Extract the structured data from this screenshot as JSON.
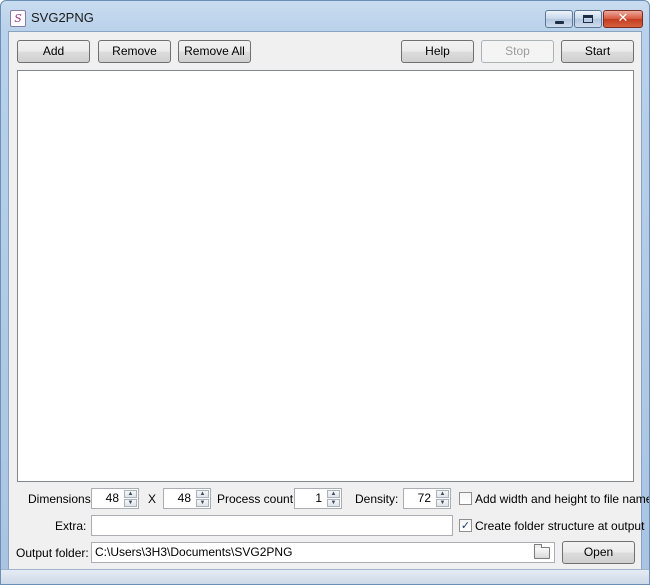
{
  "window": {
    "title": "SVG2PNG",
    "close_glyph": "✕"
  },
  "toolbar": {
    "add_label": "Add",
    "remove_label": "Remove",
    "remove_all_label": "Remove All",
    "help_label": "Help",
    "stop_label": "Stop",
    "start_label": "Start"
  },
  "settings": {
    "dimensions_label": "Dimensions:",
    "width_value": "48",
    "x_label": "X",
    "height_value": "48",
    "process_count_label": "Process count:",
    "process_count_value": "1",
    "density_label": "Density:",
    "density_value": "72",
    "add_wh_label": "Add width and height to file name",
    "add_wh_checked": false,
    "extra_label": "Extra:",
    "extra_value": "",
    "create_folder_label": "Create folder structure at output",
    "create_folder_checked": true,
    "output_folder_label": "Output folder:",
    "output_folder_value": "C:\\Users\\3H3\\Documents\\SVG2PNG",
    "open_label": "Open"
  },
  "icons": {
    "app": "svg2png-app-icon",
    "check_mark": "✓",
    "spin_up": "▲",
    "spin_down": "▼"
  }
}
